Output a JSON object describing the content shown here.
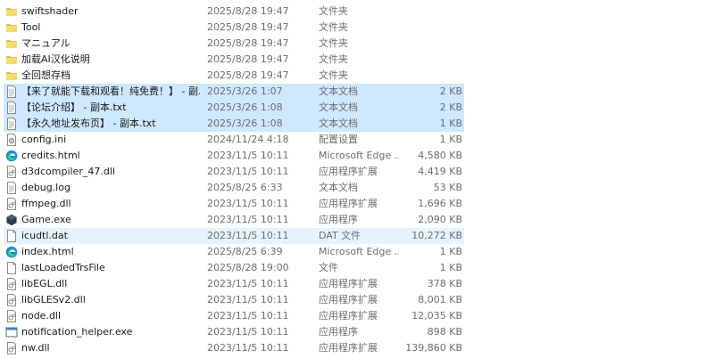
{
  "files": [
    {
      "name": "swiftshader",
      "date": "2025/8/28 19:47",
      "type": "文件夹",
      "size": "",
      "icon": "folder-icon",
      "state": ""
    },
    {
      "name": "Tool",
      "date": "2025/8/28 19:47",
      "type": "文件夹",
      "size": "",
      "icon": "folder-icon",
      "state": ""
    },
    {
      "name": "マニュアル",
      "date": "2025/8/28 19:47",
      "type": "文件夹",
      "size": "",
      "icon": "folder-icon",
      "state": ""
    },
    {
      "name": "加载AI汉化说明",
      "date": "2025/8/28 19:47",
      "type": "文件夹",
      "size": "",
      "icon": "folder-icon",
      "state": ""
    },
    {
      "name": "全回想存档",
      "date": "2025/8/28 19:47",
      "type": "文件夹",
      "size": "",
      "icon": "folder-icon",
      "state": ""
    },
    {
      "name": "【来了就能下载和观看！纯免费！】 - 副...",
      "date": "2025/3/26 1:07",
      "type": "文本文档",
      "size": "2 KB",
      "icon": "text-file-icon",
      "state": "selected"
    },
    {
      "name": "【论坛介绍】 - 副本.txt",
      "date": "2025/3/26 1:08",
      "type": "文本文档",
      "size": "2 KB",
      "icon": "text-file-icon",
      "state": "selected"
    },
    {
      "name": "【永久地址发布页】 - 副本.txt",
      "date": "2025/3/26 1:08",
      "type": "文本文档",
      "size": "1 KB",
      "icon": "text-file-icon",
      "state": "selected"
    },
    {
      "name": "config.ini",
      "date": "2024/11/24 4:18",
      "type": "配置设置",
      "size": "1 KB",
      "icon": "config-file-icon",
      "state": ""
    },
    {
      "name": "credits.html",
      "date": "2023/11/5 10:11",
      "type": "Microsoft Edge ...",
      "size": "4,580 KB",
      "icon": "edge-icon",
      "state": ""
    },
    {
      "name": "d3dcompiler_47.dll",
      "date": "2023/11/5 10:11",
      "type": "应用程序扩展",
      "size": "4,419 KB",
      "icon": "dll-file-icon",
      "state": ""
    },
    {
      "name": "debug.log",
      "date": "2025/8/25 6:33",
      "type": "文本文档",
      "size": "53 KB",
      "icon": "text-file-icon",
      "state": ""
    },
    {
      "name": "ffmpeg.dll",
      "date": "2023/11/5 10:11",
      "type": "应用程序扩展",
      "size": "1,696 KB",
      "icon": "dll-file-icon",
      "state": ""
    },
    {
      "name": "Game.exe",
      "date": "2023/11/5 10:11",
      "type": "应用程序",
      "size": "2,090 KB",
      "icon": "game-exe-icon",
      "state": ""
    },
    {
      "name": "icudtl.dat",
      "date": "2023/11/5 10:11",
      "type": "DAT 文件",
      "size": "10,272 KB",
      "icon": "file-icon",
      "state": "hover"
    },
    {
      "name": "index.html",
      "date": "2025/8/25 6:39",
      "type": "Microsoft Edge ...",
      "size": "1 KB",
      "icon": "edge-icon",
      "state": ""
    },
    {
      "name": "lastLoadedTrsFile",
      "date": "2025/8/28 19:00",
      "type": "文件",
      "size": "1 KB",
      "icon": "file-icon",
      "state": ""
    },
    {
      "name": "libEGL.dll",
      "date": "2023/11/5 10:11",
      "type": "应用程序扩展",
      "size": "378 KB",
      "icon": "dll-file-icon",
      "state": ""
    },
    {
      "name": "libGLESv2.dll",
      "date": "2023/11/5 10:11",
      "type": "应用程序扩展",
      "size": "8,001 KB",
      "icon": "dll-file-icon",
      "state": ""
    },
    {
      "name": "node.dll",
      "date": "2023/11/5 10:11",
      "type": "应用程序扩展",
      "size": "12,035 KB",
      "icon": "dll-file-icon",
      "state": ""
    },
    {
      "name": "notification_helper.exe",
      "date": "2023/11/5 10:11",
      "type": "应用程序",
      "size": "898 KB",
      "icon": "exe-window-icon",
      "state": ""
    },
    {
      "name": "nw.dll",
      "date": "2023/11/5 10:11",
      "type": "应用程序扩展",
      "size": "139,860 KB",
      "icon": "dll-file-icon",
      "state": ""
    }
  ],
  "colors": {
    "selected": "#cde8ff",
    "hover": "#e5f3ff",
    "folder": "#f8d775",
    "secondary_text": "#6d6d6d"
  }
}
